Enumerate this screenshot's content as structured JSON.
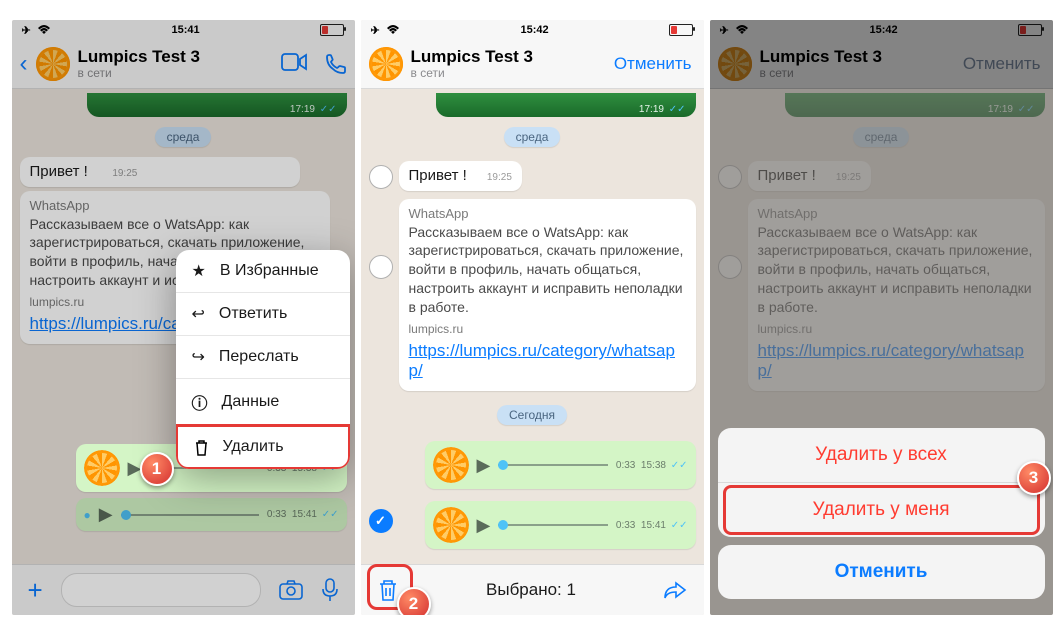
{
  "status": {
    "time1": "15:41",
    "time2": "15:42",
    "time3": "15:42"
  },
  "contact": {
    "name": "Lumpics Test 3",
    "status": "в сети"
  },
  "cancel": "Отменить",
  "video_time": "17:19",
  "day1": "среда",
  "day2": "Сегодня",
  "msg_hello": {
    "text": "Привет !",
    "time": "19:25"
  },
  "article": {
    "head": "WhatsApp",
    "body": "Рассказываем все о WatsApp: как зарегистрироваться, скачать приложение, войти в профиль, начать общаться, настроить аккаунт и исправить неполадки в работе.",
    "body_short": "Рассказываем все о WatsApp: как зарегистрироваться, скачать приложение, войти в профиль, начать общаться, настроить аккаунт и исправ…",
    "site": "lumpics.ru"
  },
  "link_short": "https://lumpics.ru/category/whatsapp/",
  "link_full": "https://lumpics.ru/category/whatsapp/",
  "voice1": {
    "dur": "0:33",
    "time": "15:38"
  },
  "voice2": {
    "dur": "0:33",
    "time": "15:41"
  },
  "ctx": {
    "fav": "В Избранные",
    "reply": "Ответить",
    "forward": "Переслать",
    "info": "Данные",
    "delete": "Удалить"
  },
  "selection_bar": "Выбрано: 1",
  "sheet": {
    "del_all": "Удалить у всех",
    "del_me": "Удалить у меня",
    "cancel": "Отменить"
  },
  "badges": {
    "b1": "1",
    "b2": "2",
    "b3": "3"
  }
}
